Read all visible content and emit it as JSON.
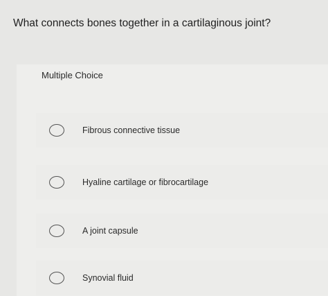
{
  "question": {
    "text": "What connects bones together in a cartilaginous joint?"
  },
  "card": {
    "type_label": "Multiple Choice"
  },
  "options": [
    {
      "label": "Fibrous connective tissue"
    },
    {
      "label": "Hyaline cartilage or fibrocartilage"
    },
    {
      "label": "A joint capsule"
    },
    {
      "label": "Synovial fluid"
    }
  ],
  "icons": {
    "radio": "radio-circle-icon"
  }
}
